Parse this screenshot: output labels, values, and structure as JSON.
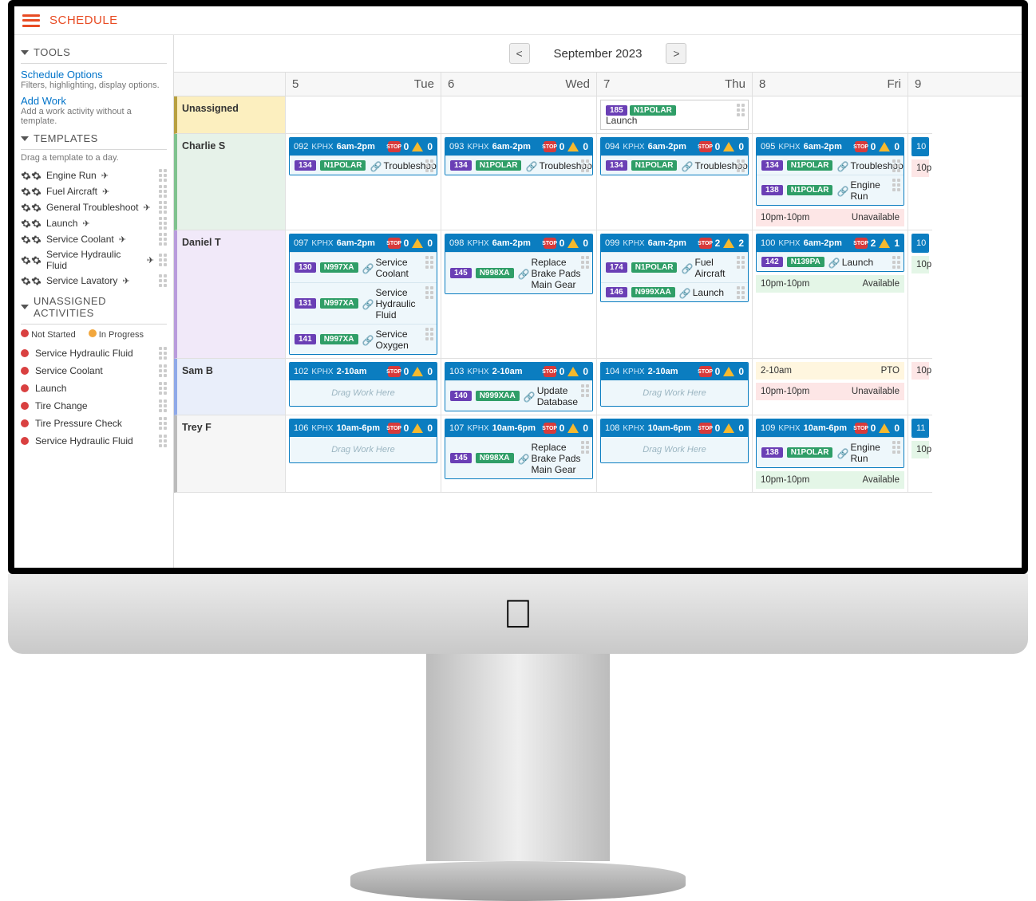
{
  "header": {
    "title": "SCHEDULE"
  },
  "tools": {
    "heading": "TOOLS",
    "schedule_options": "Schedule Options",
    "schedule_options_sub": "Filters, highlighting, display options.",
    "add_work": "Add Work",
    "add_work_sub": "Add a work activity without a template."
  },
  "templates": {
    "heading": "TEMPLATES",
    "hint": "Drag a template to a day.",
    "items": [
      "Engine Run",
      "Fuel Aircraft",
      "General Troubleshoot",
      "Launch",
      "Service Coolant",
      "Service Hydraulic Fluid",
      "Service Lavatory"
    ]
  },
  "unassigned_act": {
    "heading": "UNASSIGNED ACTIVITIES",
    "legend_ns": "Not Started",
    "legend_ip": "In Progress",
    "items": [
      "Service Hydraulic Fluid",
      "Service Coolant",
      "Launch",
      "Tire Change",
      "Tire Pressure Check",
      "Service Hydraulic Fluid"
    ]
  },
  "month_nav": {
    "prev": "<",
    "label": "September 2023",
    "next": ">"
  },
  "days": [
    {
      "num": "5",
      "dow": "Tue"
    },
    {
      "num": "6",
      "dow": "Wed"
    },
    {
      "num": "7",
      "dow": "Thu"
    },
    {
      "num": "8",
      "dow": "Fri"
    },
    {
      "num": "9",
      "dow": ""
    }
  ],
  "rows": {
    "unassigned": "Unassigned",
    "charlie": "Charlie S",
    "daniel": "Daniel T",
    "sam": "Sam B",
    "trey": "Trey F"
  },
  "launch_event": {
    "pill": "185",
    "tag": "N1POLAR",
    "name": "Launch"
  },
  "shifts": {
    "c_tue": {
      "id": "092",
      "loc": "KPHX",
      "time": "6am-2pm",
      "stop": "0",
      "warn": "0"
    },
    "c_wed": {
      "id": "093",
      "loc": "KPHX",
      "time": "6am-2pm",
      "stop": "0",
      "warn": "0"
    },
    "c_thu": {
      "id": "094",
      "loc": "KPHX",
      "time": "6am-2pm",
      "stop": "0",
      "warn": "0"
    },
    "c_fri": {
      "id": "095",
      "loc": "KPHX",
      "time": "6am-2pm",
      "stop": "0",
      "warn": "0"
    },
    "d_tue": {
      "id": "097",
      "loc": "KPHX",
      "time": "6am-2pm",
      "stop": "0",
      "warn": "0"
    },
    "d_wed": {
      "id": "098",
      "loc": "KPHX",
      "time": "6am-2pm",
      "stop": "0",
      "warn": "0"
    },
    "d_thu": {
      "id": "099",
      "loc": "KPHX",
      "time": "6am-2pm",
      "stop": "2",
      "warn": "2"
    },
    "d_fri": {
      "id": "100",
      "loc": "KPHX",
      "time": "6am-2pm",
      "stop": "2",
      "warn": "1"
    },
    "s_tue": {
      "id": "102",
      "loc": "KPHX",
      "time": "2-10am",
      "stop": "0",
      "warn": "0"
    },
    "s_wed": {
      "id": "103",
      "loc": "KPHX",
      "time": "2-10am",
      "stop": "0",
      "warn": "0"
    },
    "s_thu": {
      "id": "104",
      "loc": "KPHX",
      "time": "2-10am",
      "stop": "0",
      "warn": "0"
    },
    "t_tue": {
      "id": "106",
      "loc": "KPHX",
      "time": "10am-6pm",
      "stop": "0",
      "warn": "0"
    },
    "t_wed": {
      "id": "107",
      "loc": "KPHX",
      "time": "10am-6pm",
      "stop": "0",
      "warn": "0"
    },
    "t_thu": {
      "id": "108",
      "loc": "KPHX",
      "time": "10am-6pm",
      "stop": "0",
      "warn": "0"
    },
    "t_fri": {
      "id": "109",
      "loc": "KPHX",
      "time": "10am-6pm",
      "stop": "0",
      "warn": "0"
    }
  },
  "tasks": {
    "c_tue_1": {
      "pill": "134",
      "tag": "N1POLAR",
      "name": "Troubleshoot"
    },
    "c_wed_1": {
      "pill": "134",
      "tag": "N1POLAR",
      "name": "Troubleshoot"
    },
    "c_thu_1": {
      "pill": "134",
      "tag": "N1POLAR",
      "name": "Troubleshoot"
    },
    "c_fri_1": {
      "pill": "134",
      "tag": "N1POLAR",
      "name": "Troubleshoot"
    },
    "c_fri_2": {
      "pill": "138",
      "tag": "N1POLAR",
      "name": "Engine Run"
    },
    "d_tue_1": {
      "pill": "130",
      "tag": "N997XA",
      "name": "Service Coolant"
    },
    "d_tue_2": {
      "pill": "131",
      "tag": "N997XA",
      "name": "Service Hydraulic Fluid"
    },
    "d_tue_3": {
      "pill": "141",
      "tag": "N997XA",
      "name": "Service Oxygen"
    },
    "d_wed_1": {
      "pill": "145",
      "tag": "N998XA",
      "name": "Replace Brake Pads Main Gear"
    },
    "d_thu_1": {
      "pill": "174",
      "tag": "N1POLAR",
      "name": "Fuel Aircraft"
    },
    "d_thu_2": {
      "pill": "146",
      "tag": "N999XAA",
      "name": "Launch"
    },
    "d_fri_1": {
      "pill": "142",
      "tag": "N139PA",
      "name": "Launch"
    },
    "s_wed_1": {
      "pill": "140",
      "tag": "N999XAA",
      "name": "Update Database"
    },
    "t_wed_1": {
      "pill": "145",
      "tag": "N998XA",
      "name": "Replace Brake Pads Main Gear"
    },
    "t_fri_1": {
      "pill": "138",
      "tag": "N1POLAR",
      "name": "Engine Run"
    }
  },
  "avail": {
    "time_10_10": "10pm-10pm",
    "unavailable": "Unavailable",
    "available": "Available",
    "pto_range": "2-10am",
    "pto": "PTO",
    "edge_10p": "10p"
  },
  "drag_here": "Drag Work Here"
}
